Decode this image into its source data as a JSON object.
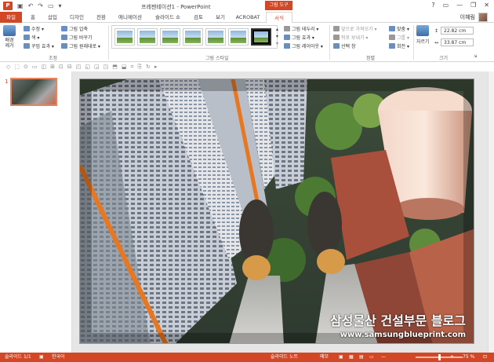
{
  "titlebar": {
    "app_badge": "P",
    "title": "프레젠테이션1 - PowerPoint",
    "context_group": "그림 도구",
    "controls": [
      "?",
      "▭",
      "—",
      "❐",
      "✕"
    ]
  },
  "tabs": [
    {
      "label": "파일",
      "kind": "file"
    },
    {
      "label": "홈"
    },
    {
      "label": "삽입"
    },
    {
      "label": "디자인"
    },
    {
      "label": "전환"
    },
    {
      "label": "애니메이션"
    },
    {
      "label": "슬라이드 쇼"
    },
    {
      "label": "검토"
    },
    {
      "label": "보기"
    },
    {
      "label": "ACROBAT"
    },
    {
      "label": "서식",
      "kind": "active"
    }
  ],
  "user": {
    "name": "이혜림"
  },
  "ribbon": {
    "adjust": {
      "remove_bg": "배경\n제거",
      "correct": "수정 ▾",
      "color": "색 ▾",
      "artistic": "꾸밈 효과 ▾",
      "compress": "그림 압축",
      "change": "그림 바꾸기",
      "reset": "그림 원래대로 ▾",
      "group_label": "조정"
    },
    "styles": {
      "group_label": "그림 스타일",
      "border": "그림 테두리 ▾",
      "effects": "그림 효과 ▾",
      "layout": "그림 레이아웃 ▾"
    },
    "arrange": {
      "group_label": "정렬",
      "forward": "앞으로 가져오기 ▾",
      "backward": "뒤로 보내기 ▾",
      "selection": "선택 창",
      "align": "맞춤 ▾",
      "group": "그룹 ▾",
      "rotate": "회전 ▾"
    },
    "size": {
      "group_label": "크기",
      "crop": "자르기",
      "height": "22.82 cm",
      "width": "33.87 cm"
    }
  },
  "thumbnails": {
    "slide_number": "1"
  },
  "slide": {
    "watermark_line1": "삼성물산 건설부문 블로그",
    "watermark_line2": "www.samsungblueprint.com"
  },
  "status": {
    "slide_info": "슬라이드 1/1",
    "language": "한국어",
    "notes": "슬라이드 노트",
    "comments": "메모",
    "zoom": "75 %"
  },
  "colors": {
    "accent": "#d24726"
  }
}
